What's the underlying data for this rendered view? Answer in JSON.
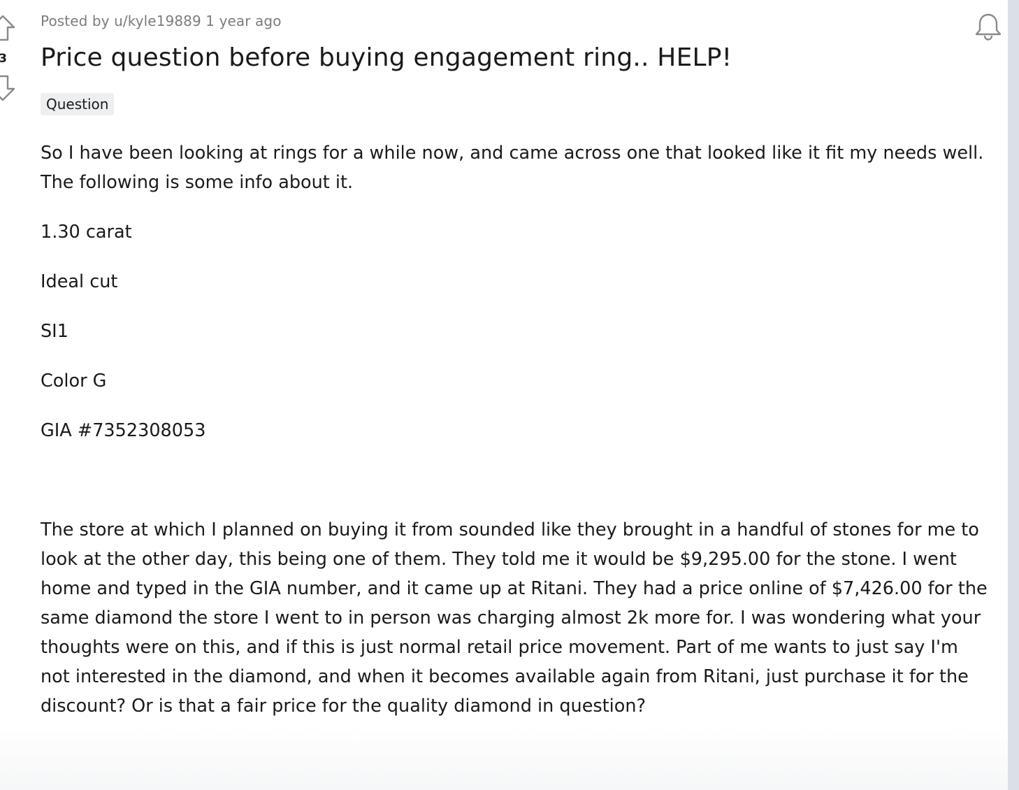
{
  "post": {
    "score": "3",
    "posted_by_prefix": "Posted by",
    "author": "u/kyle19889",
    "age": "1 year ago",
    "title": "Price question before buying engagement ring.. HELP!",
    "flair": "Question",
    "body": [
      "So I have been looking at rings for a while now, and came across one that looked like it fit my needs well. The following is some info about it.",
      "1.30 carat",
      "Ideal cut",
      "SI1",
      "Color G",
      "GIA #7352308053",
      "",
      "The store at which I planned on buying it from sounded like they brought in a handful of stones for me to look at the other day, this being one of them. They told me it would be $9,295.00 for the stone. I went home and typed in the GIA number, and it came up at Ritani. They had a price online of $7,426.00 for the same diamond the store I went to in person was charging almost 2k more for. I was wondering what your thoughts were on this, and if this is just normal retail price movement. Part of me wants to just say I'm not interested in the diamond, and when it becomes available again from Ritani, just purchase it for the discount? Or is that a fair price for the quality diamond in question?"
    ]
  },
  "icons": {
    "upvote": "upvote-arrow-icon",
    "downvote": "downvote-arrow-icon",
    "notifications": "bell-icon"
  },
  "colors": {
    "text": "#1a1a1b",
    "meta": "#7c7c7c",
    "flair_bg": "#edeff1",
    "icon": "#878a8c"
  }
}
